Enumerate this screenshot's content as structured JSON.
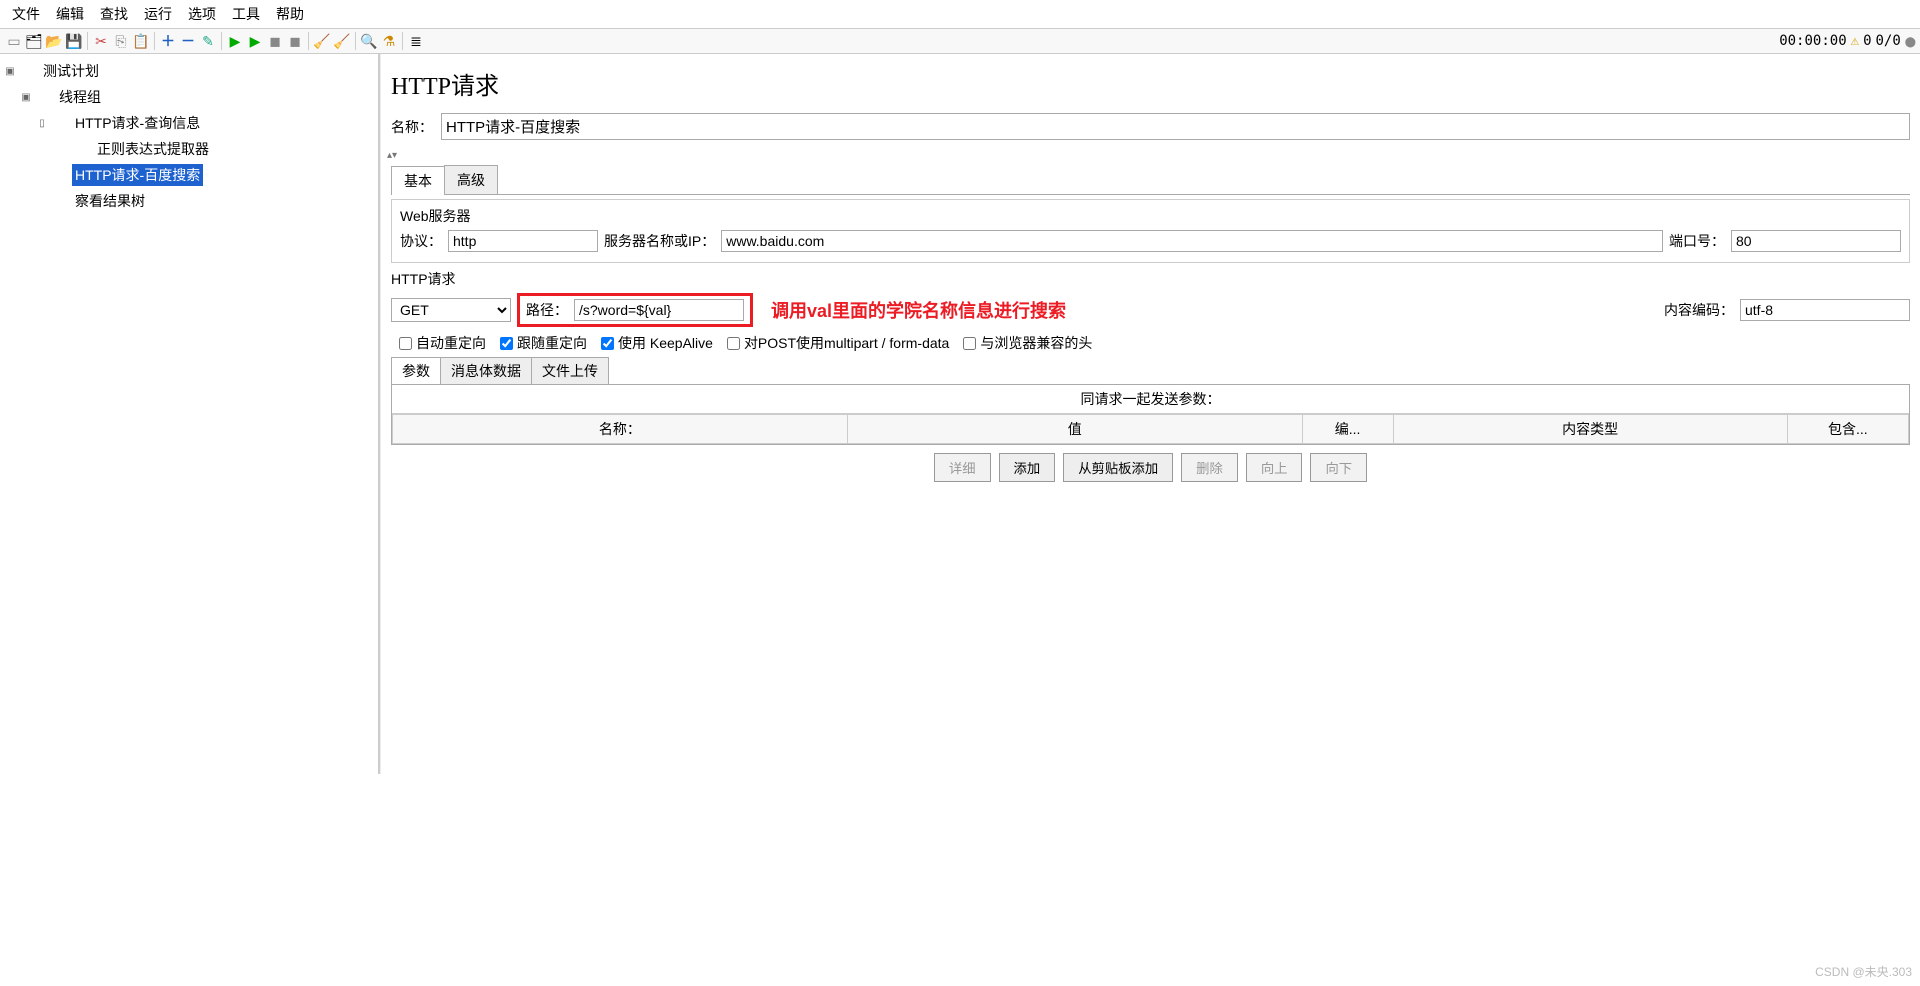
{
  "menu": {
    "items": [
      "文件",
      "编辑",
      "查找",
      "运行",
      "选项",
      "工具",
      "帮助"
    ]
  },
  "toolbar_right": {
    "time": "00:00:00",
    "warn_count": "0",
    "err": "0/0"
  },
  "tree": {
    "root": {
      "label": "测试计划"
    },
    "n1": {
      "label": "线程组"
    },
    "n2": {
      "label": "HTTP请求-查询信息"
    },
    "n3": {
      "label": "正则表达式提取器"
    },
    "n4": {
      "label": "HTTP请求-百度搜索"
    },
    "n5": {
      "label": "察看结果树"
    }
  },
  "panel": {
    "title": "HTTP请求",
    "name_label": "名称：",
    "name_value": "HTTP请求-百度搜索",
    "tabs": {
      "basic": "基本",
      "advanced": "高级"
    },
    "web": {
      "legend": "Web服务器",
      "proto_label": "协议：",
      "proto_value": "http",
      "server_label": "服务器名称或IP：",
      "server_value": "www.baidu.com",
      "port_label": "端口号：",
      "port_value": "80"
    },
    "httpreq": {
      "legend": "HTTP请求",
      "method": "GET",
      "path_label": "路径：",
      "path_value": "/s?word=${val}",
      "annotation": "调用val里面的学院名称信息进行搜索",
      "enc_label": "内容编码：",
      "enc_value": "utf-8"
    },
    "checks": {
      "auto": "自动重定向",
      "follow": "跟随重定向",
      "keepalive": "使用 KeepAlive",
      "multipart": "对POST使用multipart / form-data",
      "browser": "与浏览器兼容的头"
    },
    "subtabs": {
      "params": "参数",
      "body": "消息体数据",
      "files": "文件上传"
    },
    "params_title": "同请求一起发送参数：",
    "columns": {
      "name": "名称：",
      "value": "值",
      "enc": "编...",
      "ctype": "内容类型",
      "incl": "包含..."
    },
    "buttons": {
      "detail": "详细",
      "add": "添加",
      "clip": "从剪贴板添加",
      "del": "删除",
      "up": "向上",
      "down": "向下"
    }
  },
  "watermark": "CSDN @未央.303"
}
